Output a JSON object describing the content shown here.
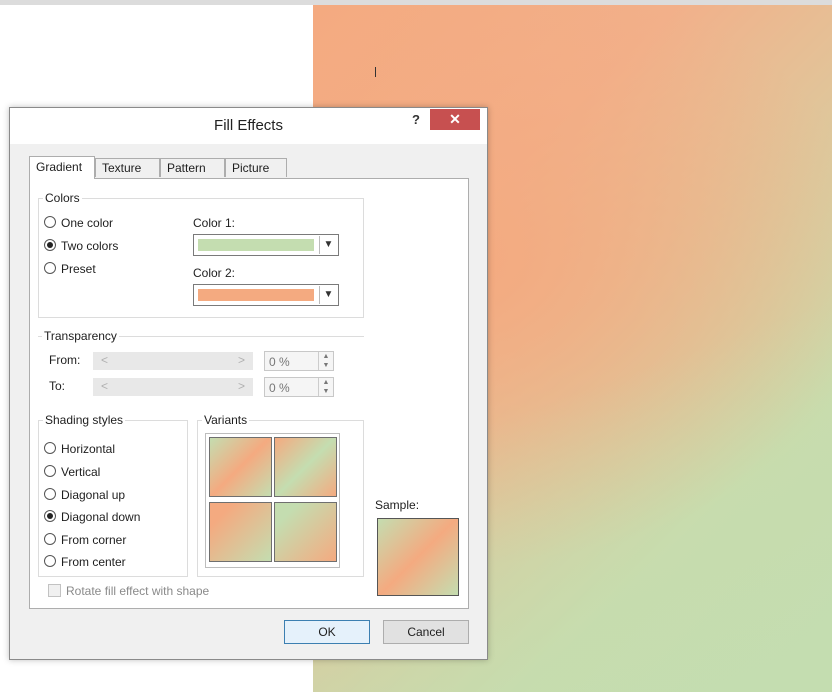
{
  "dialog": {
    "title": "Fill Effects",
    "help_label": "?",
    "close_label": "✕"
  },
  "tabs": [
    {
      "label": "Gradient"
    },
    {
      "label": "Texture"
    },
    {
      "label": "Pattern"
    },
    {
      "label": "Picture"
    }
  ],
  "colors": {
    "legend": "Colors",
    "options": [
      {
        "label": "One color",
        "selected": false
      },
      {
        "label": "Two colors",
        "selected": true
      },
      {
        "label": "Preset",
        "selected": false
      }
    ],
    "color1_label": "Color 1:",
    "color1_value": "#c4ddb0",
    "color2_label": "Color 2:",
    "color2_value": "#f4aa80"
  },
  "transparency": {
    "legend": "Transparency",
    "from_label": "From:",
    "from_value": "0 %",
    "to_label": "To:",
    "to_value": "0 %"
  },
  "shading": {
    "legend": "Shading styles",
    "options": [
      {
        "label": "Horizontal",
        "selected": false
      },
      {
        "label": "Vertical",
        "selected": false
      },
      {
        "label": "Diagonal up",
        "selected": false
      },
      {
        "label": "Diagonal down",
        "selected": true
      },
      {
        "label": "From corner",
        "selected": false
      },
      {
        "label": "From center",
        "selected": false
      }
    ]
  },
  "variants": {
    "legend": "Variants"
  },
  "sample": {
    "label": "Sample:"
  },
  "rotate_checkbox": {
    "label": "Rotate fill effect with shape",
    "checked": false,
    "enabled": false
  },
  "buttons": {
    "ok": "OK",
    "cancel": "Cancel"
  }
}
